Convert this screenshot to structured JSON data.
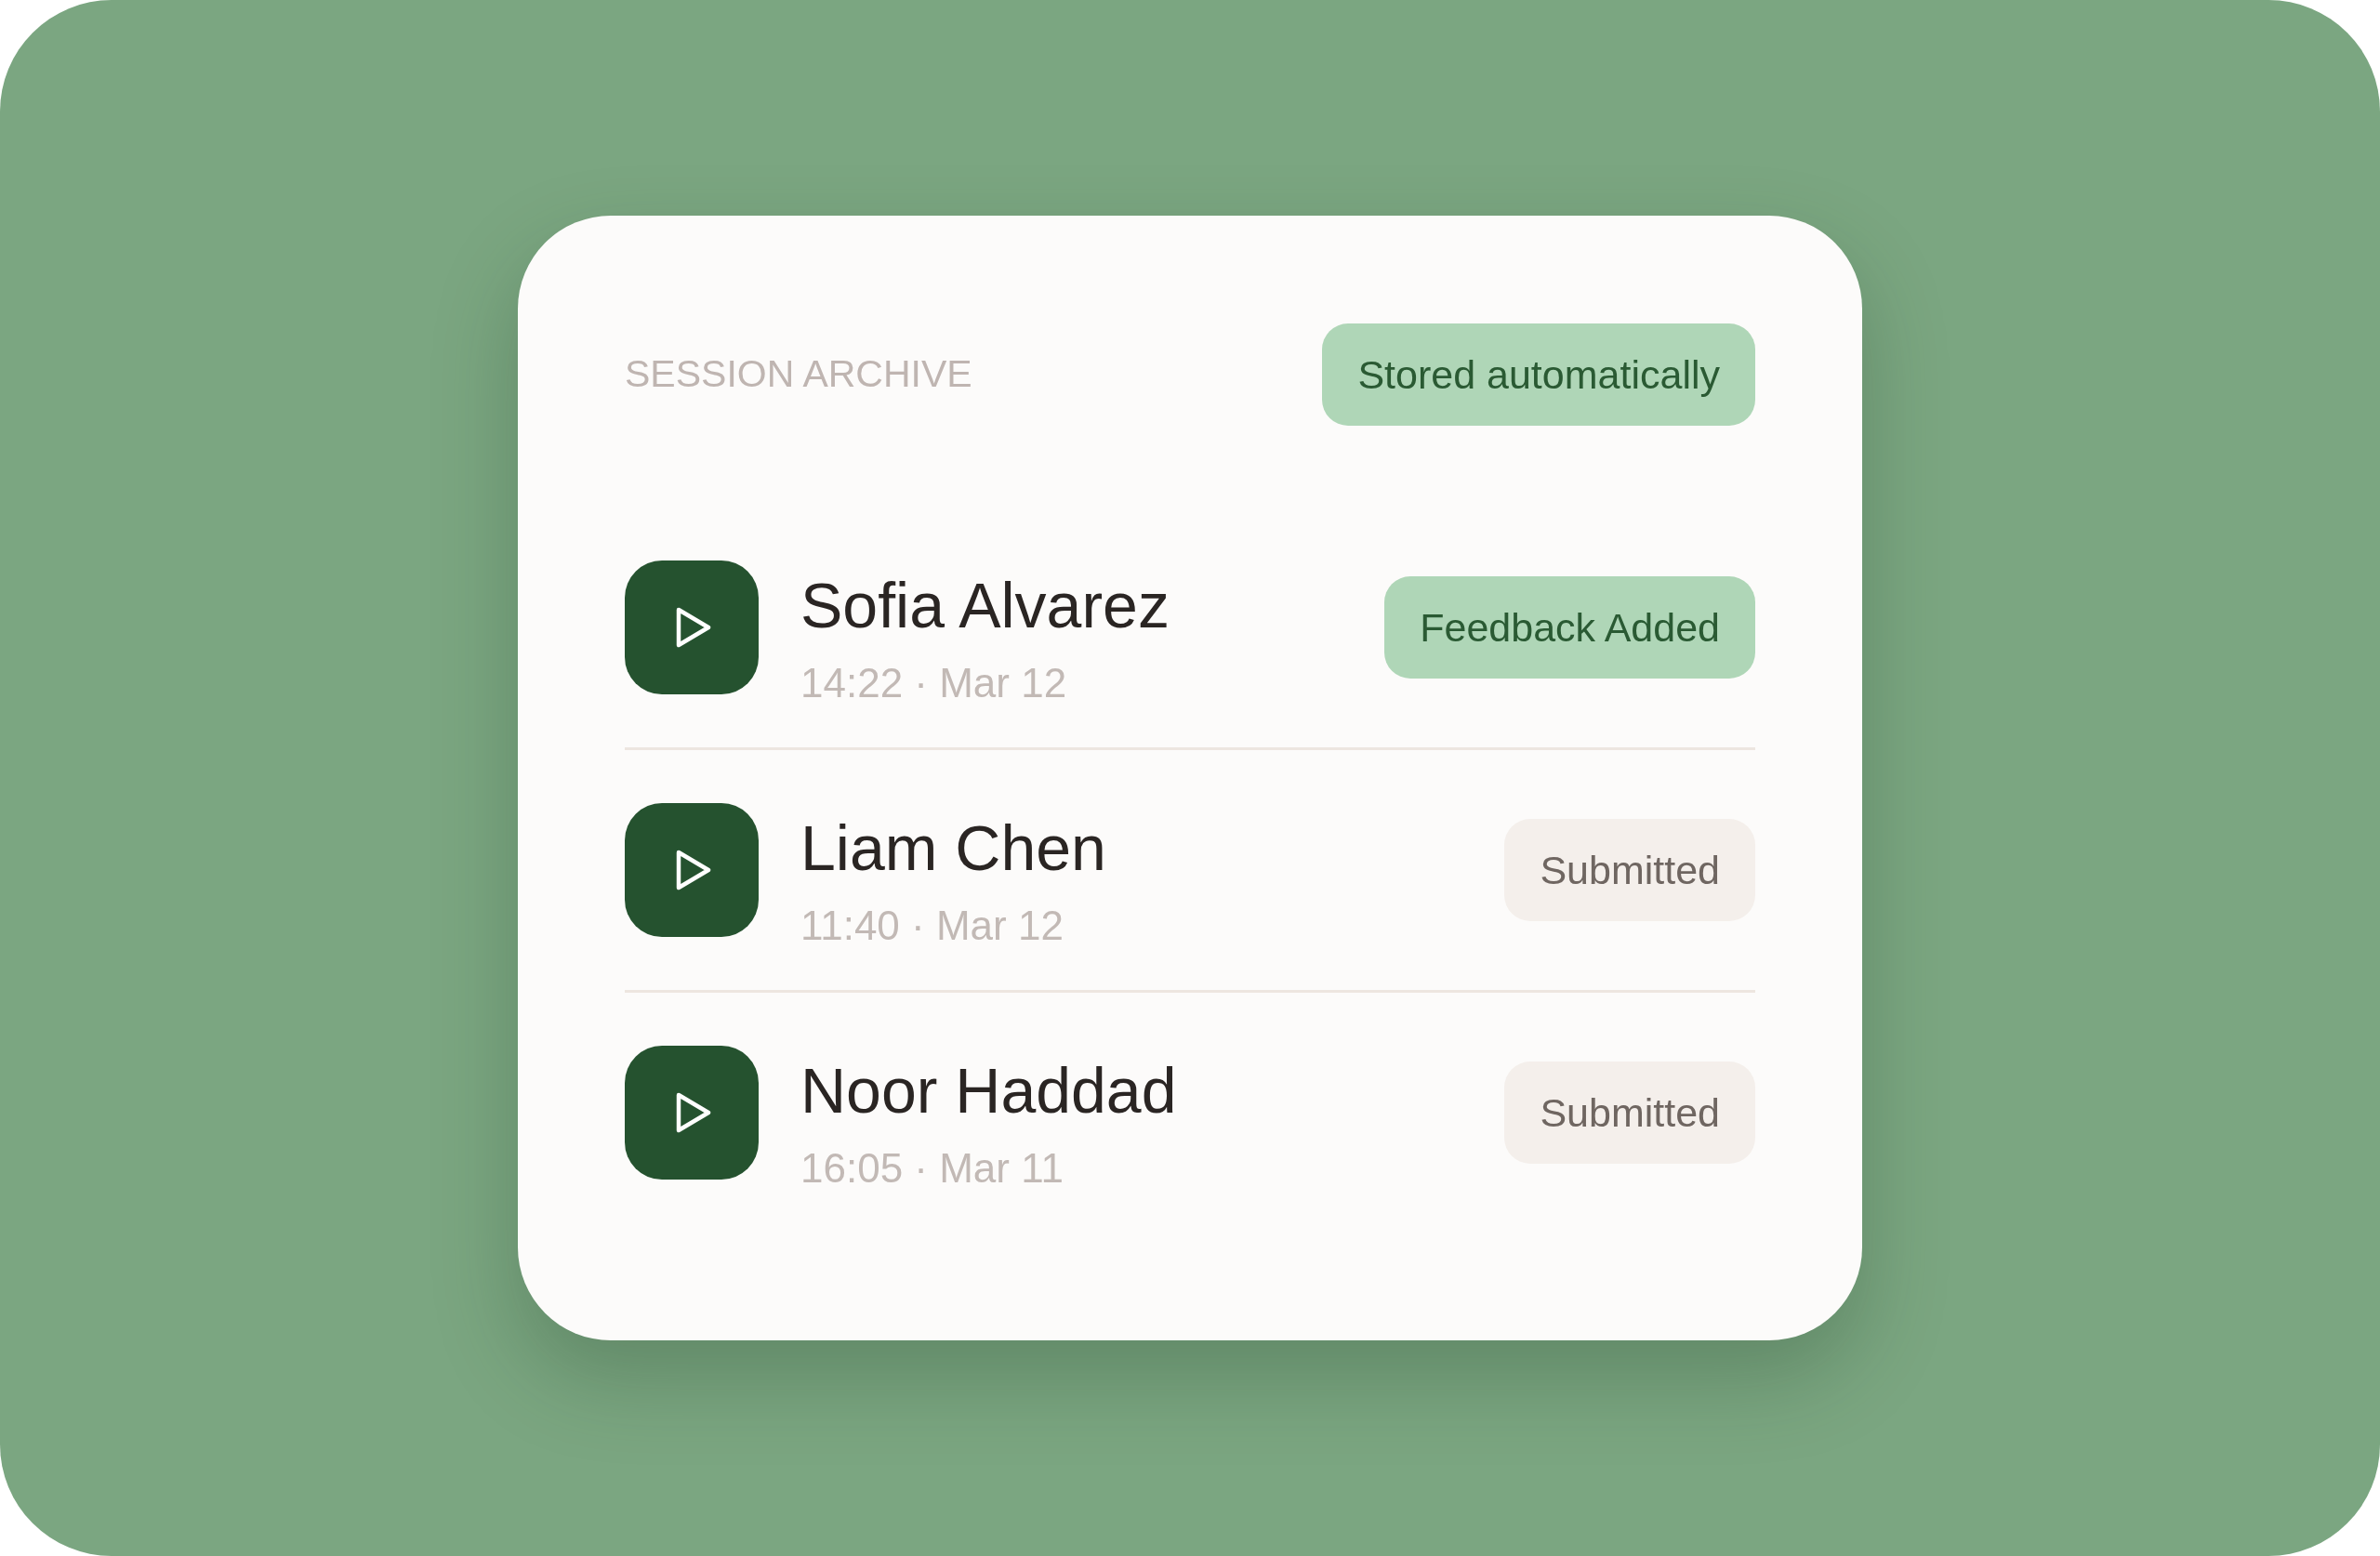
{
  "header": {
    "title": "SESSION ARCHIVE",
    "badge": "Stored automatically"
  },
  "sessions": [
    {
      "name": "Sofia Alvarez",
      "time": "14:22 · Mar 12",
      "status": {
        "label": "Feedback Added",
        "kind": "feedback"
      }
    },
    {
      "name": "Liam Chen",
      "time": "11:40 · Mar 12",
      "status": {
        "label": "Submitted",
        "kind": "submitted"
      }
    },
    {
      "name": "Noor Haddad",
      "time": "16:05 · Mar 11",
      "status": {
        "label": "Submitted",
        "kind": "submitted"
      }
    }
  ]
}
